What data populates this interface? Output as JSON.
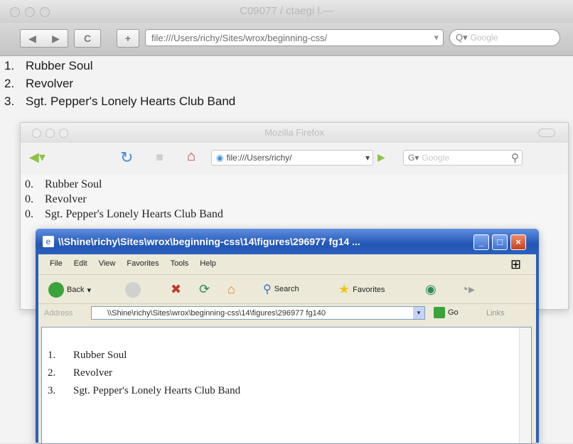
{
  "safari": {
    "window_title": "C09077 / ctaegi l.—",
    "url": "file:///Users/richy/Sites/wrox/beginning-css/",
    "search_placeholder": "Google",
    "list": [
      {
        "num": "1.",
        "text": "Rubber Soul"
      },
      {
        "num": "2.",
        "text": "Revolver"
      },
      {
        "num": "3.",
        "text": "Sgt. Pepper's Lonely Hearts Club Band"
      }
    ]
  },
  "firefox": {
    "window_title": "Mozilla Firefox",
    "url": "file:///Users/richy/",
    "search_placeholder": "Google",
    "list": [
      {
        "num": "0.",
        "text": "Rubber Soul"
      },
      {
        "num": "0.",
        "text": "Revolver"
      },
      {
        "num": "0.",
        "text": "Sgt. Pepper's Lonely Hearts Club Band"
      }
    ]
  },
  "ie": {
    "window_title": "\\\\Shine\\richy\\Sites\\wrox\\beginning-css\\14\\figures\\296977 fg14 ...",
    "menu": [
      "File",
      "Edit",
      "View",
      "Favorites",
      "Tools",
      "Help"
    ],
    "toolbar": {
      "back": "Back",
      "search": "Search",
      "favorites": "Favorites"
    },
    "address_label": "Address",
    "address": "\\\\Shine\\richy\\Sites\\wrox\\beginning-css\\14\\figures\\296977 fg140",
    "go_label": "Go",
    "links_label": "Links",
    "list": [
      {
        "num": "1.",
        "text": "Rubber Soul"
      },
      {
        "num": "2.",
        "text": "Revolver"
      },
      {
        "num": "3.",
        "text": "Sgt. Pepper's Lonely Hearts Club Band"
      }
    ]
  }
}
